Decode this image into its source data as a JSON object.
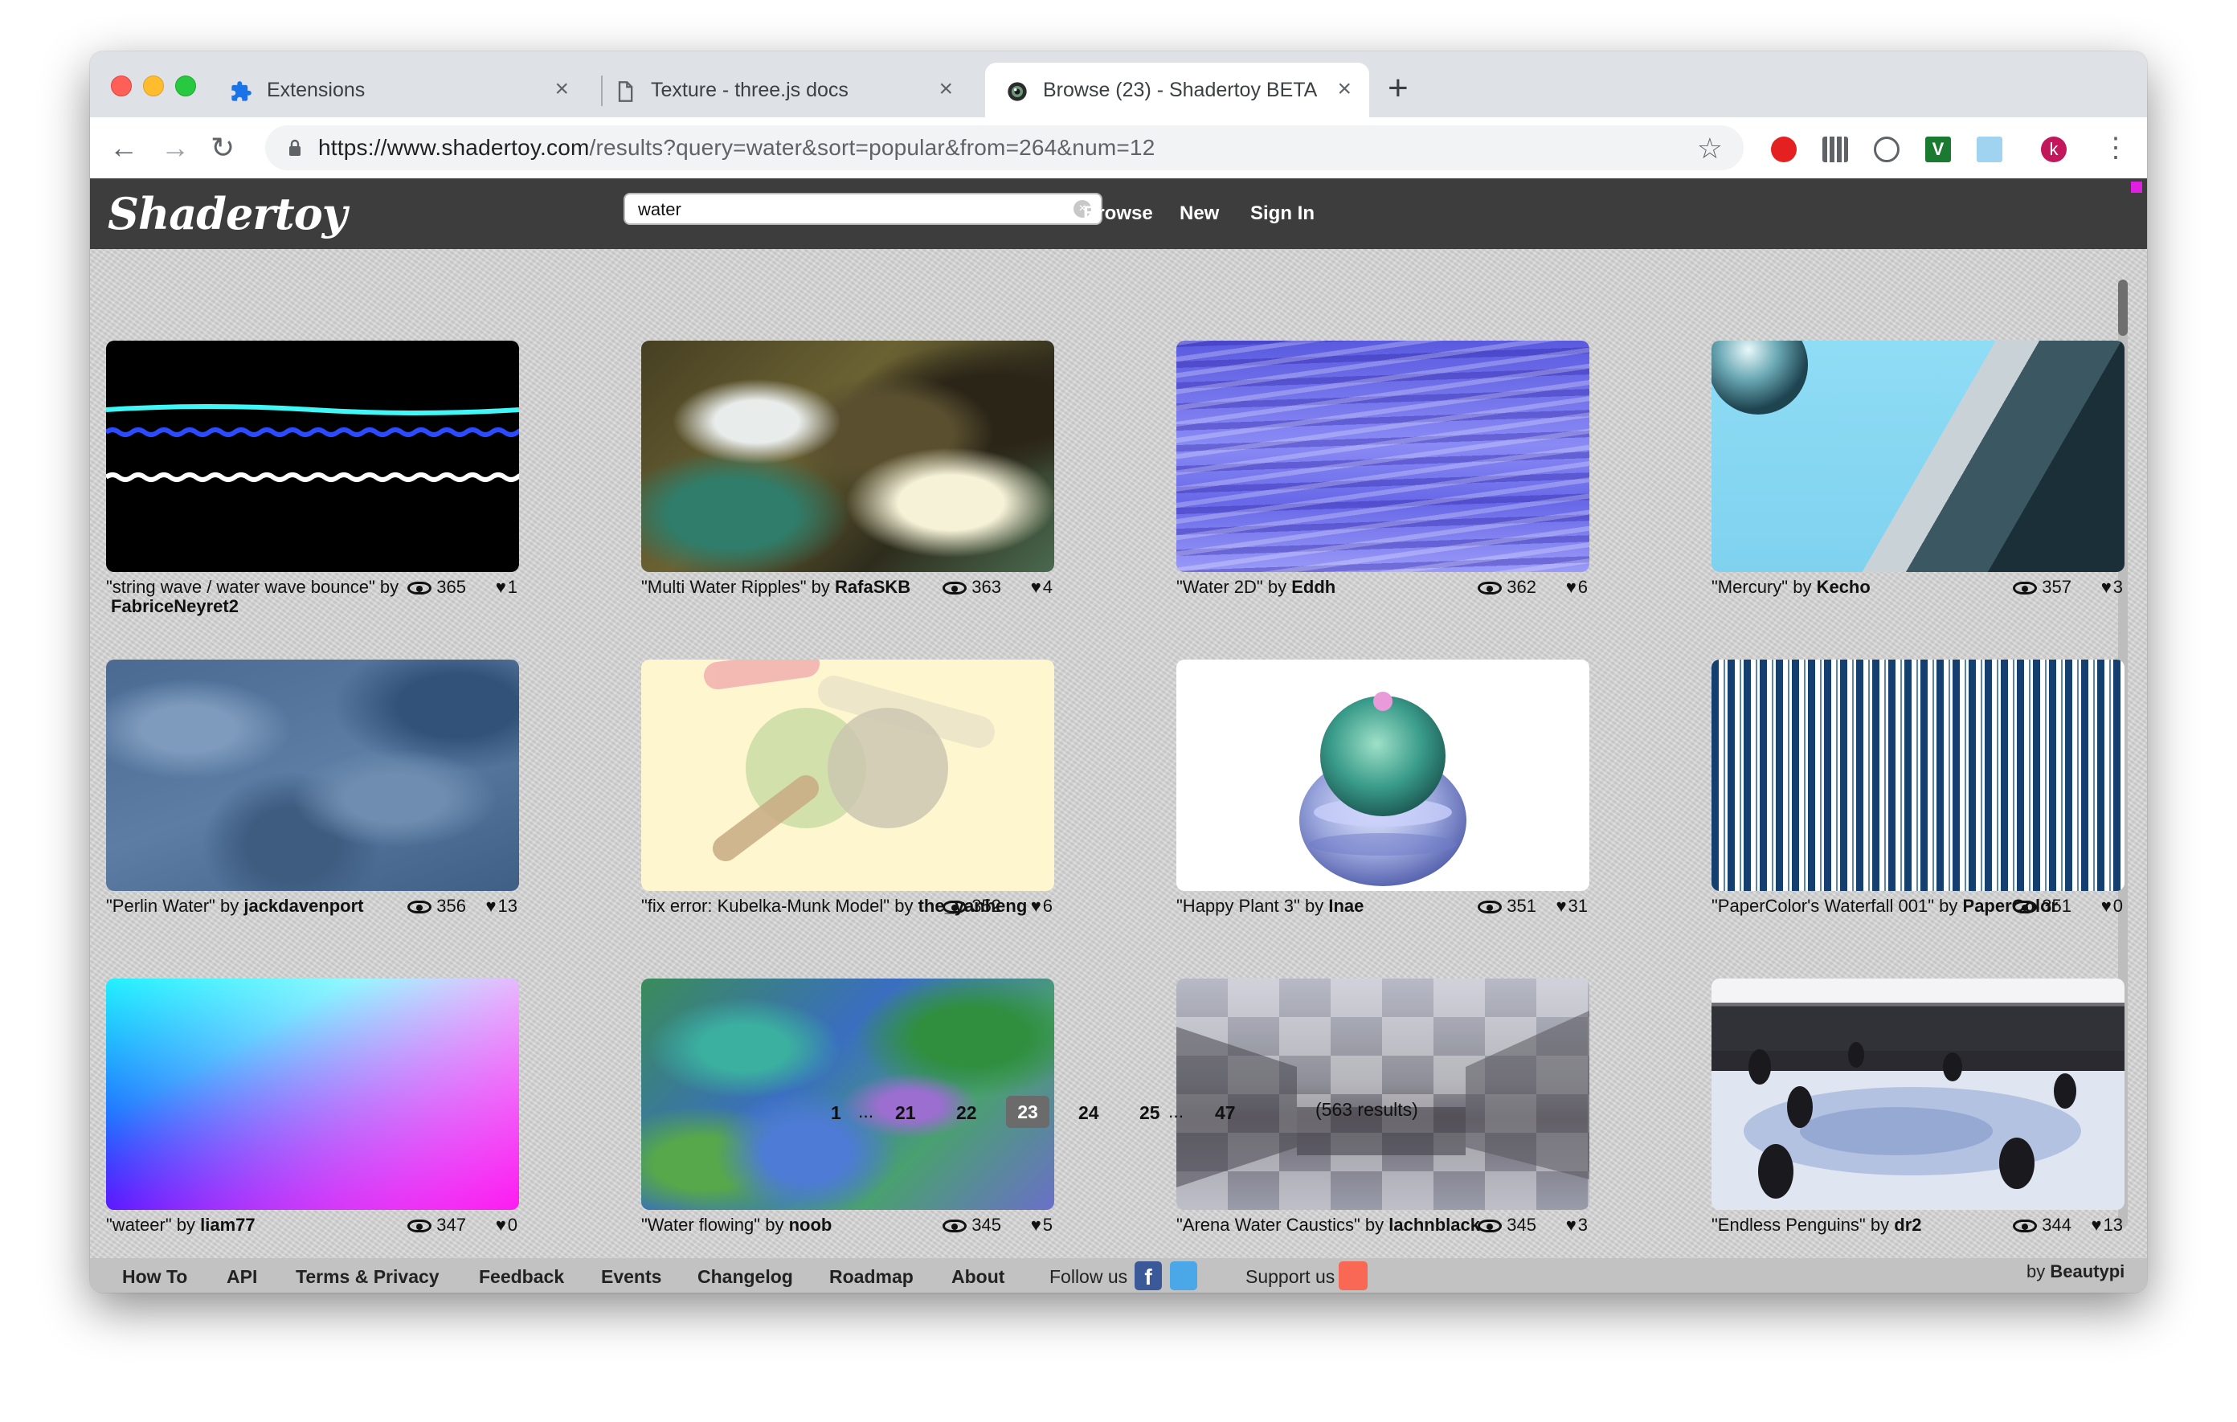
{
  "browser": {
    "tabs": [
      {
        "label": "Extensions",
        "icon": "puzzle-icon"
      },
      {
        "label": "Texture - three.js docs",
        "icon": "page-icon"
      },
      {
        "label": "Browse (23) - Shadertoy BETA",
        "icon": "shadertoy-favicon-icon",
        "active": true
      }
    ],
    "url_host": "https://www.shadertoy.com",
    "url_rest": "/results?query=water&sort=popular&from=264&num=12",
    "profile_initial": "k"
  },
  "site": {
    "logo": "Shadertoy",
    "search_value": "water",
    "nav": {
      "browse": "Browse",
      "new": "New",
      "signin": "Sign In"
    }
  },
  "cards": [
    {
      "title": "\"string wave / water wave bounce\"",
      "by": "by",
      "author": "FabriceNeyret2",
      "views": "365",
      "likes": "1"
    },
    {
      "title": "\"Multi Water Ripples\"",
      "by": "by",
      "author": "RafaSKB",
      "views": "363",
      "likes": "4"
    },
    {
      "title": "\"Water 2D\"",
      "by": "by",
      "author": "Eddh",
      "views": "362",
      "likes": "6"
    },
    {
      "title": "\"Mercury\"",
      "by": "by",
      "author": "Kecho",
      "views": "357",
      "likes": "3"
    },
    {
      "title": "\"Perlin Water\"",
      "by": "by",
      "author": "jackdavenport",
      "views": "356",
      "likes": "13"
    },
    {
      "title": "\"fix error: Kubelka-Munk Model\"",
      "by": "by",
      "author": "the_yanheng",
      "views": "352",
      "likes": "6"
    },
    {
      "title": "\"Happy Plant 3\"",
      "by": "by",
      "author": "Inae",
      "views": "351",
      "likes": "31"
    },
    {
      "title": "\"PaperColor's Waterfall 001\"",
      "by": "by",
      "author": "PaperColor",
      "views": "351",
      "likes": "0"
    },
    {
      "title": "\"wateer\"",
      "by": "by",
      "author": "liam77",
      "views": "347",
      "likes": "0"
    },
    {
      "title": "\"Water flowing\"",
      "by": "by",
      "author": "noob",
      "views": "345",
      "likes": "5"
    },
    {
      "title": "\"Arena Water Caustics\"",
      "by": "by",
      "author": "lachnblack",
      "views": "345",
      "likes": "3"
    },
    {
      "title": "\"Endless Penguins\"",
      "by": "by",
      "author": "dr2",
      "views": "344",
      "likes": "13"
    }
  ],
  "pagination": {
    "first": "1",
    "p21": "21",
    "p22": "22",
    "current": "23",
    "p24": "24",
    "p25": "25",
    "last": "47",
    "ellipsis": "...",
    "results": "(563 results)"
  },
  "footer": {
    "howto": "How To",
    "api": "API",
    "terms": "Terms & Privacy",
    "feedback": "Feedback",
    "events": "Events",
    "changelog": "Changelog",
    "roadmap": "Roadmap",
    "about": "About",
    "follow": "Follow us",
    "support": "Support us",
    "by": "by",
    "byname": "Beautypi"
  }
}
